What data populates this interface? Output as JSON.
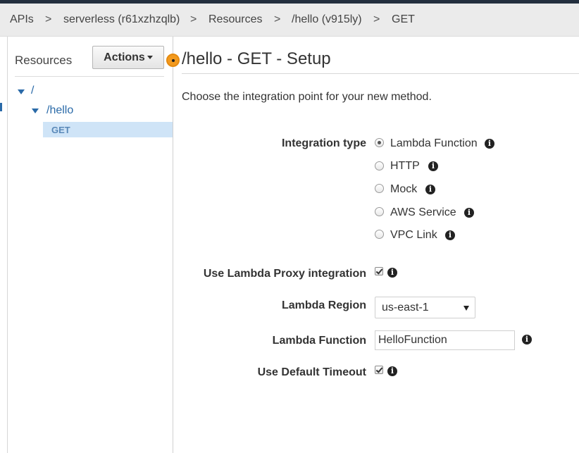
{
  "breadcrumb": {
    "items": [
      "APIs",
      "serverless (r61xzhzqlb)",
      "Resources",
      "/hello (v915ly)",
      "GET"
    ],
    "separator": ">"
  },
  "sidebar": {
    "title": "Resources",
    "actions_label": "Actions",
    "tree": {
      "root": "/",
      "child": "/hello",
      "method": "GET"
    }
  },
  "main": {
    "title": "/hello - GET - Setup",
    "intro": "Choose the integration point for your new method.",
    "integration_type": {
      "label": "Integration type",
      "options": [
        "Lambda Function",
        "HTTP",
        "Mock",
        "AWS Service",
        "VPC Link"
      ],
      "selected": "Lambda Function"
    },
    "lambda_proxy": {
      "label": "Use Lambda Proxy integration",
      "checked": true
    },
    "lambda_region": {
      "label": "Lambda Region",
      "value": "us-east-1"
    },
    "lambda_function": {
      "label": "Lambda Function",
      "value": "HelloFunction"
    },
    "default_timeout": {
      "label": "Use Default Timeout",
      "checked": true
    }
  },
  "icons": {
    "info": "info-icon",
    "status": "orange-dot-icon"
  },
  "colors": {
    "link": "#2a6aa8",
    "selected_row": "#cfe4f7",
    "accent": "#f39a1e"
  }
}
